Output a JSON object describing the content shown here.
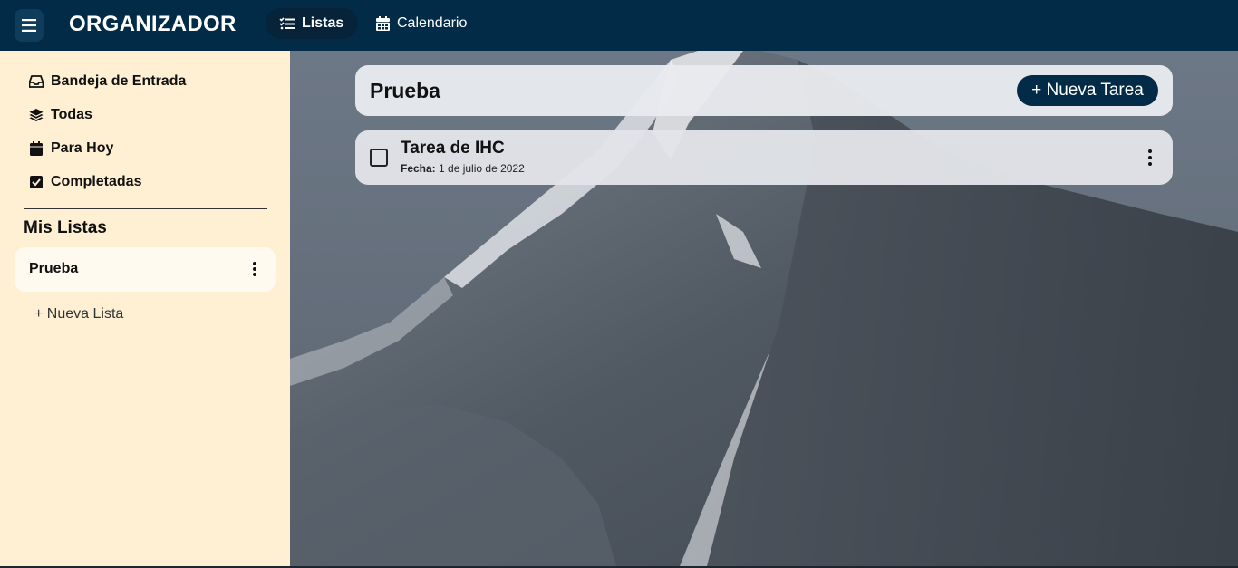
{
  "app": {
    "title": "ORGANIZADOR"
  },
  "header": {
    "tabs": [
      {
        "label": "Listas",
        "icon": "list-check-icon",
        "active": true
      },
      {
        "label": "Calendario",
        "icon": "calendar-icon",
        "active": false
      }
    ]
  },
  "sidebar": {
    "nav": [
      {
        "label": "Bandeja de Entrada",
        "icon": "inbox-icon"
      },
      {
        "label": "Todas",
        "icon": "layers-icon"
      },
      {
        "label": "Para Hoy",
        "icon": "calendar-day-icon"
      },
      {
        "label": "Completadas",
        "icon": "check-square-icon"
      }
    ],
    "section_title": "Mis Listas",
    "lists": [
      {
        "label": "Prueba"
      }
    ],
    "new_list_label": "+ Nueva Lista"
  },
  "main": {
    "list_title": "Prueba",
    "new_task_label": "+ Nueva Tarea",
    "tasks": [
      {
        "title": "Tarea de IHC",
        "date_label": "Fecha:",
        "date_value": "1 de julio de 2022",
        "completed": false
      }
    ]
  },
  "colors": {
    "brand": "#022b47",
    "sidebar_bg": "#fff0d4",
    "list_card_bg": "#fffaf0"
  }
}
